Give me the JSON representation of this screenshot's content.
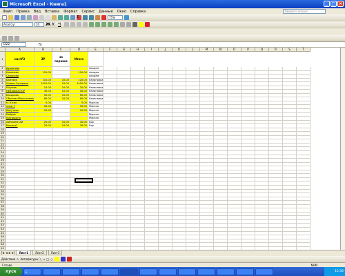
{
  "window": {
    "title": "Microsoft Excel - Книга1"
  },
  "menu": [
    "Файл",
    "Правка",
    "Вид",
    "Вставка",
    "Формат",
    "Сервис",
    "Данные",
    "Окно",
    "Справка"
  ],
  "help_placeholder": "Введите вопрос",
  "toolbar": {
    "font_name": "Arial Cyr",
    "font_size": "10",
    "zoom": "75%"
  },
  "namebox": "D22",
  "fx": "fx",
  "columns": [
    "A",
    "B",
    "C",
    "D",
    "E",
    "F",
    "G",
    "H",
    "I",
    "J",
    "K",
    "L",
    "M",
    "N",
    "O",
    "P",
    "Q",
    "R",
    "S",
    "T"
  ],
  "header": {
    "a": "нас/УЗ",
    "b": "ЗР",
    "c": "за перевоз",
    "d": "Итого"
  },
  "rows": [
    {
      "n": "2",
      "a": "Душанова",
      "b": "",
      "c": "",
      "d": "",
      "e": "Академ"
    },
    {
      "n": "3",
      "a": "Ильясова",
      "b": "110.00",
      "c": "",
      "d": "110.00",
      "e": "Академ"
    },
    {
      "n": "4",
      "a": "Сапарова",
      "b": "",
      "c": "",
      "d": "",
      "e": "Академ"
    },
    {
      "n": "5",
      "a": "Байтаев",
      "b": "110.00",
      "c": "10.00",
      "d": "120.00",
      "e": "Калиновка"
    },
    {
      "n": "6",
      "a": "Юзиев Сапаровы",
      "b": "1410.00",
      "c": "10.00",
      "d": "1420.00",
      "e": "Калиновка"
    },
    {
      "n": "7",
      "a": "Юсупов",
      "b": "10.00",
      "c": "10.00",
      "d": "20.00",
      "e": "Калиновка"
    },
    {
      "n": "8",
      "a": "НЕВЗАЙСКТОР",
      "b": "30.00",
      "c": "10.00",
      "d": "40.00",
      "e": "Калиновка"
    },
    {
      "n": "9",
      "a": "Бакирова",
      "b": "50.00",
      "c": "10.00",
      "d": "60.00",
      "e": "Калиновка"
    },
    {
      "n": "10",
      "a": "Обжиев Айжигалиева",
      "b": "80.00",
      "c": "10.00",
      "d": "90.00",
      "e": "Калиновка"
    },
    {
      "n": "11",
      "a": "Н. Юсин",
      "b": "5.00",
      "c": "",
      "d": "5.00",
      "e": "Маркса"
    },
    {
      "n": "12",
      "a": "этаж 7",
      "b": "90.00",
      "c": "",
      "d": "90.00",
      "e": "Маркса"
    },
    {
      "n": "13",
      "a": "Кикутова",
      "b": "10.00",
      "c": "",
      "d": "10.00",
      "e": "Маркса"
    },
    {
      "n": "14",
      "a": "Байдак",
      "b": "",
      "c": "",
      "d": "",
      "e": "Маркса"
    },
    {
      "n": "15",
      "a": "Усеницына",
      "b": "",
      "c": "",
      "d": "",
      "e": "Маркса"
    },
    {
      "n": "16",
      "a": "АЙЯЗАЕВТАЙ",
      "b": "20.00",
      "c": "10.00",
      "d": "30.00",
      "e": "Бор"
    },
    {
      "n": "17",
      "a": "Мысага2",
      "b": "20.00",
      "c": "10.00",
      "d": "30.00",
      "e": "Бор"
    }
  ],
  "empty_row_numbers": [
    "18",
    "19",
    "20",
    "21",
    "22",
    "23",
    "24",
    "25",
    "26",
    "27",
    "28",
    "29",
    "30",
    "31",
    "32",
    "33",
    "34",
    "35",
    "36",
    "37",
    "38",
    "39",
    "40",
    "41",
    "42",
    "43",
    "44",
    "45",
    "46",
    "47",
    "48",
    "49"
  ],
  "sheets": [
    "Лист1",
    "Лист2",
    "Лист3"
  ],
  "draw": {
    "actions": "Действия",
    "autoshapes": "Автофигуры"
  },
  "status": {
    "ready": "Готово",
    "num": "NUM"
  },
  "taskbar": {
    "start": "пуск",
    "clock": "12:56",
    "task_label": "E"
  }
}
